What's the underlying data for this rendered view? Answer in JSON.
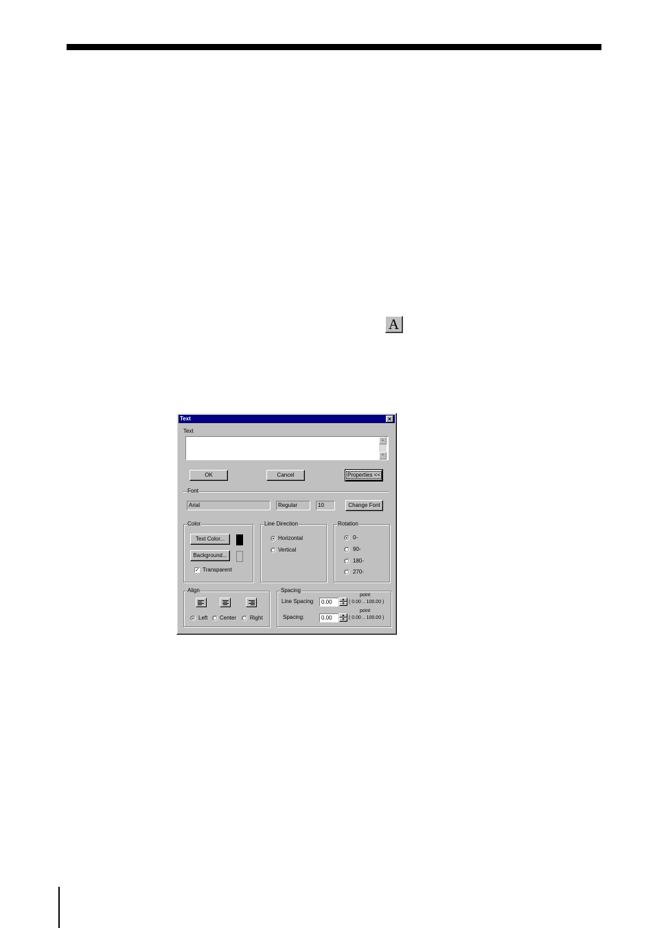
{
  "toolbar_icon": {
    "glyph": "A",
    "icon": "text-tool-icon"
  },
  "dialog": {
    "title": "Text",
    "close_glyph": "×",
    "text_label": "Text",
    "text_value": "",
    "buttons": {
      "ok": "OK",
      "cancel": "Cancel",
      "properties": "Properties <<"
    },
    "font": {
      "group": "Font",
      "name": "Arial",
      "style": "Regular",
      "size": "10",
      "change": "Change Font"
    },
    "color": {
      "group": "Color",
      "text_color_button": "Text Color...",
      "background_button": "Background...",
      "transparent_label": "Transparent",
      "transparent_checked": true,
      "text_color": "#000000",
      "background_color": "#c0c0c0"
    },
    "line_direction": {
      "group": "Line Direction",
      "options": [
        "Horizontal",
        "Vertical"
      ],
      "selected": "Horizontal"
    },
    "rotation": {
      "group": "Rotation",
      "options": [
        "0-",
        "90-",
        "180-",
        "270-"
      ],
      "selected": "0-"
    },
    "align": {
      "group": "Align",
      "options": [
        "Left",
        "Center",
        "Right"
      ],
      "selected": "Left"
    },
    "spacing": {
      "group": "Spacing",
      "line_spacing_label": "Line Spacing",
      "line_spacing_value": "0.00",
      "spacing_label": "Spacing:",
      "spacing_value": "0.00",
      "unit": "point",
      "range": "( 0.00 .. 100.00 )"
    }
  }
}
